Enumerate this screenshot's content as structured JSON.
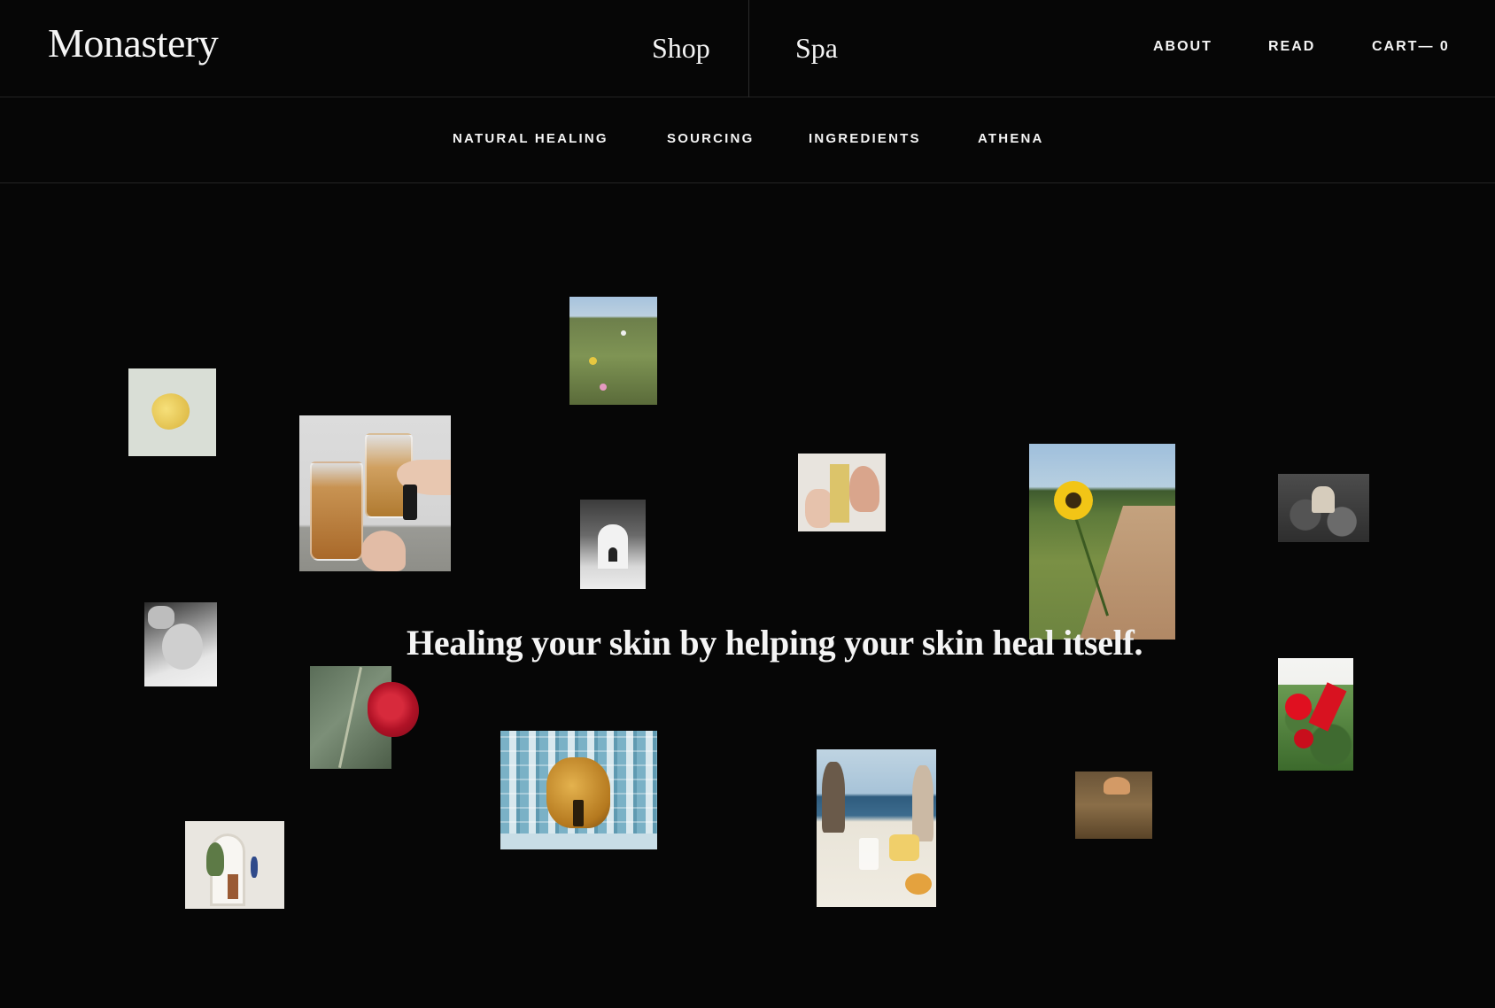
{
  "header": {
    "logo": "Monastery",
    "primary_nav": [
      {
        "label": "Shop"
      },
      {
        "label": "Spa"
      }
    ],
    "utility_nav": {
      "about": "ABOUT",
      "read": "READ",
      "cart": "CART— 0"
    }
  },
  "subnav": {
    "items": [
      {
        "label": "NATURAL HEALING"
      },
      {
        "label": "SOURCING"
      },
      {
        "label": "INGREDIENTS"
      },
      {
        "label": "ATHENA"
      }
    ]
  },
  "hero": {
    "tagline": "Healing your skin by helping  your skin heal itself."
  },
  "colors": {
    "background": "#060606",
    "text": "#f4f4f4",
    "divider": "#232323"
  }
}
